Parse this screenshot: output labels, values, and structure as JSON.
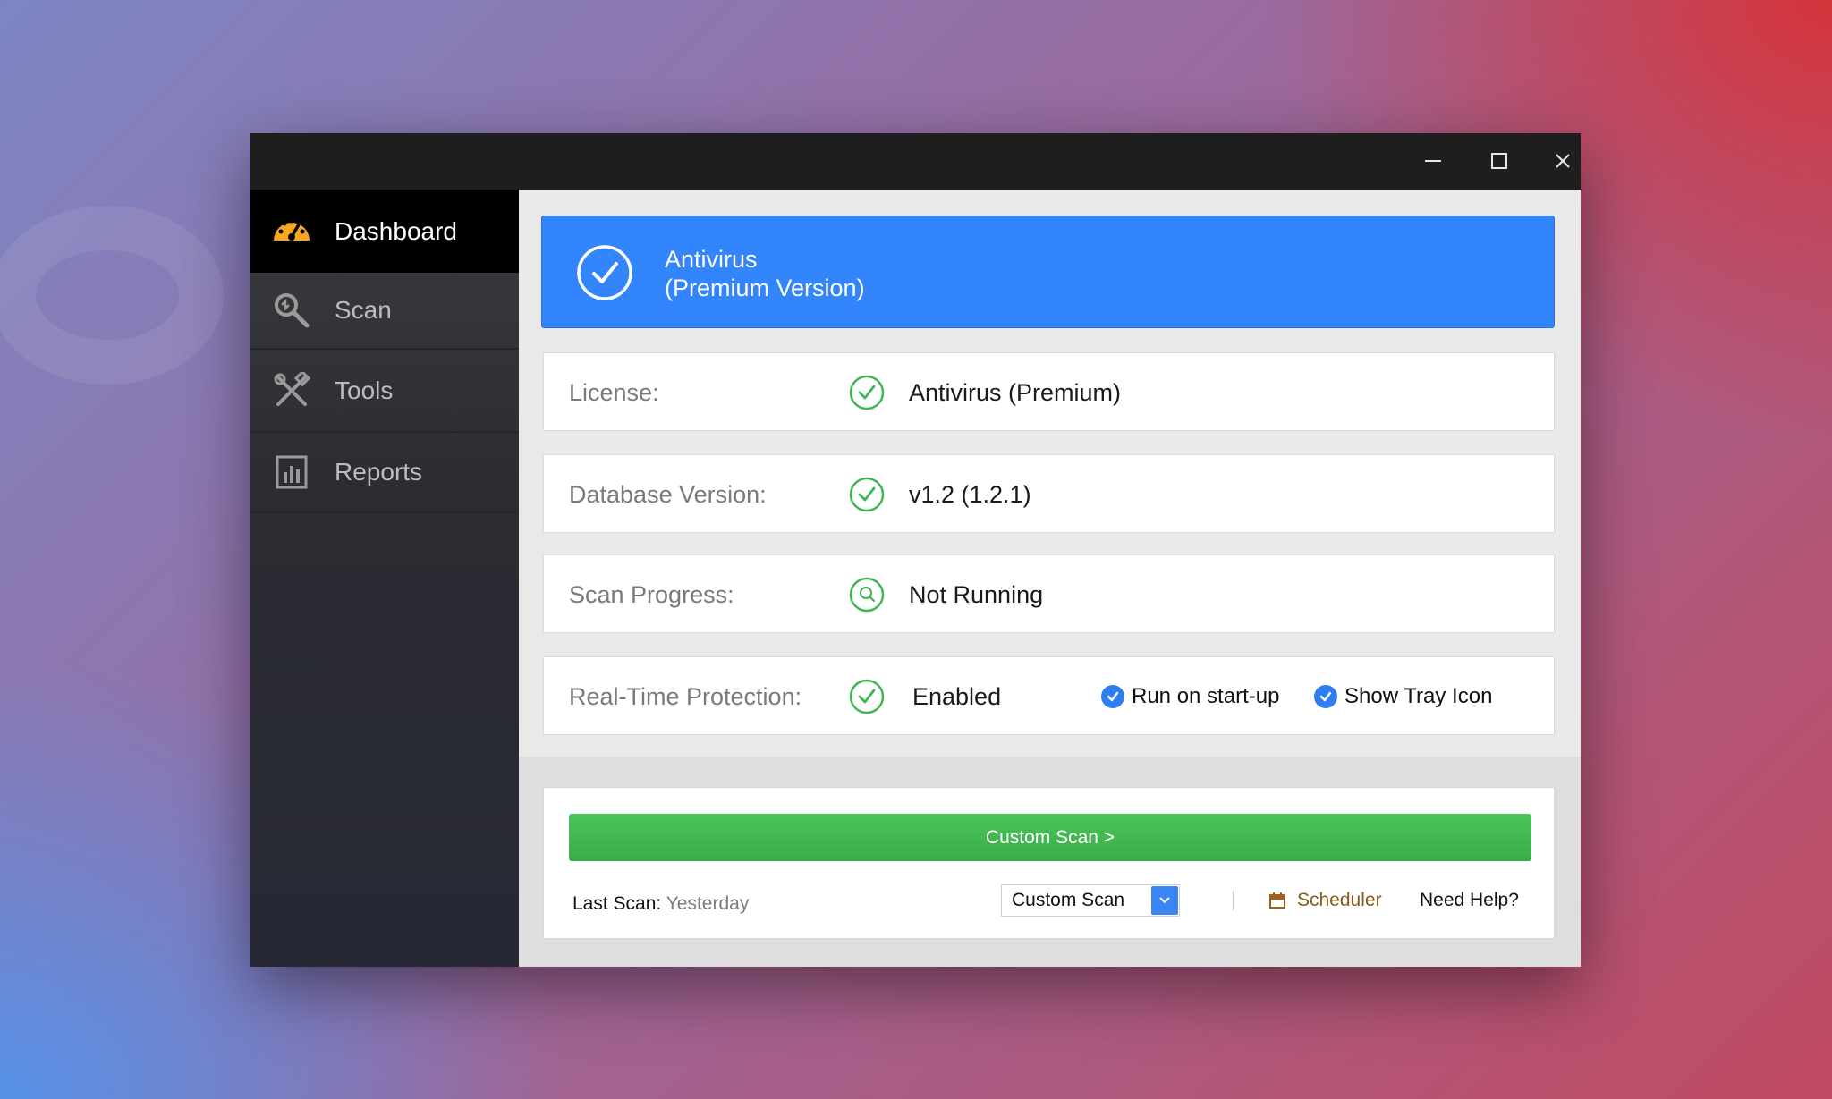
{
  "window_controls": {
    "minimize_icon": "minimize-icon",
    "maximize_icon": "maximize-icon",
    "close_icon": "close-icon"
  },
  "sidebar": {
    "items": [
      {
        "label": "Dashboard",
        "icon": "speedometer-icon",
        "active": true
      },
      {
        "label": "Scan",
        "icon": "magnifier-icon",
        "active": false
      },
      {
        "label": "Tools",
        "icon": "tools-icon",
        "active": false
      },
      {
        "label": "Reports",
        "icon": "bar-chart-icon",
        "active": false
      }
    ]
  },
  "banner": {
    "line1": "Antivirus",
    "line2": "(Premium Version)",
    "icon": "check-circle-icon",
    "color": "#3385fb"
  },
  "status": {
    "license": {
      "label": "License:",
      "value": "Antivirus (Premium)",
      "icon": "check-circle-icon"
    },
    "database": {
      "label": "Database Version:",
      "value": "v1.2 (1.2.1)",
      "icon": "check-circle-icon"
    },
    "scan_progress": {
      "label": "Scan Progress:",
      "value": "Not Running",
      "icon": "search-circle-icon"
    },
    "realtime": {
      "label": "Real-Time Protection:",
      "value": "Enabled",
      "icon": "check-circle-icon",
      "options": [
        {
          "label": "Run on start-up",
          "checked": true
        },
        {
          "label": "Show Tray Icon",
          "checked": true
        }
      ]
    },
    "ok_color": "#3fb653"
  },
  "actions": {
    "scan_button": "Custom Scan >",
    "last_scan_label": "Last Scan:",
    "last_scan_value": "Yesterday",
    "scan_type_selected": "Custom Scan",
    "scheduler_label": "Scheduler",
    "help_label": "Need Help?",
    "accent_green": "#43b851"
  }
}
